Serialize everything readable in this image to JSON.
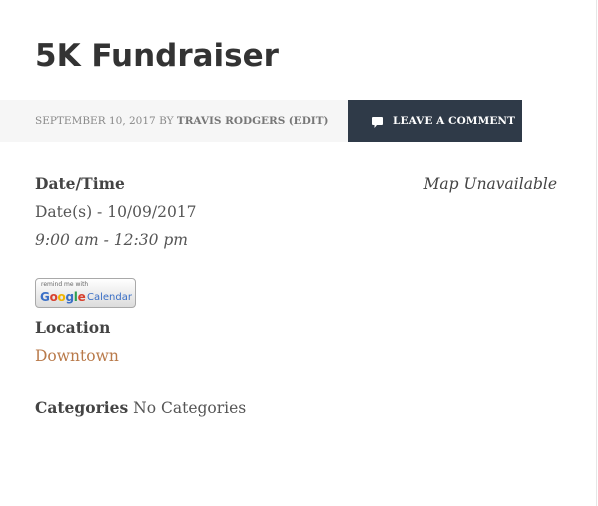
{
  "post": {
    "title": "5K Fundraiser"
  },
  "meta": {
    "date": "SEPTEMBER 10, 2017",
    "by": "BY",
    "author": "TRAVIS RODGERS",
    "edit": "(EDIT)",
    "comment_button": "LEAVE A COMMENT"
  },
  "event": {
    "datetime_heading": "Date/Time",
    "dates": "Date(s) - 10/09/2017",
    "time": "9:00 am - 12:30 pm",
    "map": "Map Unavailable",
    "gcal_small": "remind me with",
    "gcal_brand_letters": [
      "G",
      "o",
      "o",
      "g",
      "l",
      "e"
    ],
    "gcal_brand_colors": [
      "#3a6fc6",
      "#d8412f",
      "#f0b400",
      "#3a6fc6",
      "#2e9e4f",
      "#d8412f"
    ],
    "gcal_product": "Calendar",
    "location_heading": "Location",
    "location": "Downtown",
    "categories_heading": "Categories",
    "categories": "No Categories"
  },
  "colors": {
    "accent_link": "#b97a4a",
    "button_bg": "#2f3a48",
    "meta_bg": "#f6f6f6"
  },
  "icons": {
    "comment": "speech-bubble"
  }
}
